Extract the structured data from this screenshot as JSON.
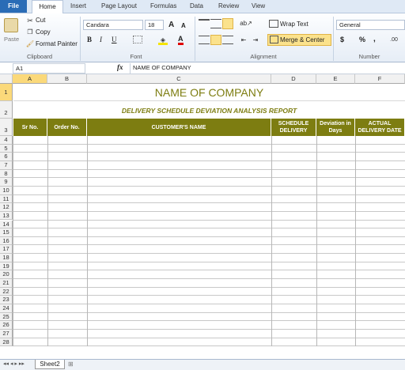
{
  "tabs": {
    "file": "File",
    "home": "Home",
    "insert": "Insert",
    "page_layout": "Page Layout",
    "formulas": "Formulas",
    "data": "Data",
    "review": "Review",
    "view": "View"
  },
  "clipboard": {
    "cut": "Cut",
    "copy": "Copy",
    "format_painter": "Format Painter",
    "paste": "Paste",
    "label": "Clipboard"
  },
  "font": {
    "name": "Candara",
    "size": "18",
    "label": "Font",
    "bold": "B",
    "italic": "I",
    "underline": "U",
    "grow": "A",
    "shrink": "A",
    "font_color": "A"
  },
  "alignment": {
    "wrap_text": "Wrap Text",
    "merge_center": "Merge & Center",
    "label": "Alignment"
  },
  "number": {
    "format": "General",
    "currency": "$",
    "percent": "%",
    "comma": ",",
    "label": "Number"
  },
  "formula_bar": {
    "name_box": "A1",
    "fx": "fx",
    "content": "NAME OF COMPANY"
  },
  "sheet": {
    "columns": [
      "A",
      "B",
      "C",
      "D",
      "E",
      "F"
    ],
    "rows": [
      "1",
      "2",
      "3",
      "4",
      "5",
      "6",
      "7",
      "8",
      "9",
      "10",
      "11",
      "12",
      "13",
      "14",
      "15",
      "16",
      "17",
      "18",
      "19",
      "20",
      "21",
      "22",
      "23",
      "24",
      "25",
      "26",
      "27",
      "28"
    ],
    "company": "NAME OF COMPANY",
    "report_title": "DELIVERY SCHEDULE DEVIATION ANALYSIS REPORT",
    "headers": [
      "Sr No.",
      "Order No.",
      "CUSTOMER'S NAME",
      "SCHEDULE DELIVERY",
      "Deviation in Days",
      "ACTUAL DELIVERY DATE"
    ],
    "title_color": "#7d7d11",
    "header_bg": "#7d7d11"
  },
  "sheet_tabs": {
    "active": "Sheet2"
  }
}
